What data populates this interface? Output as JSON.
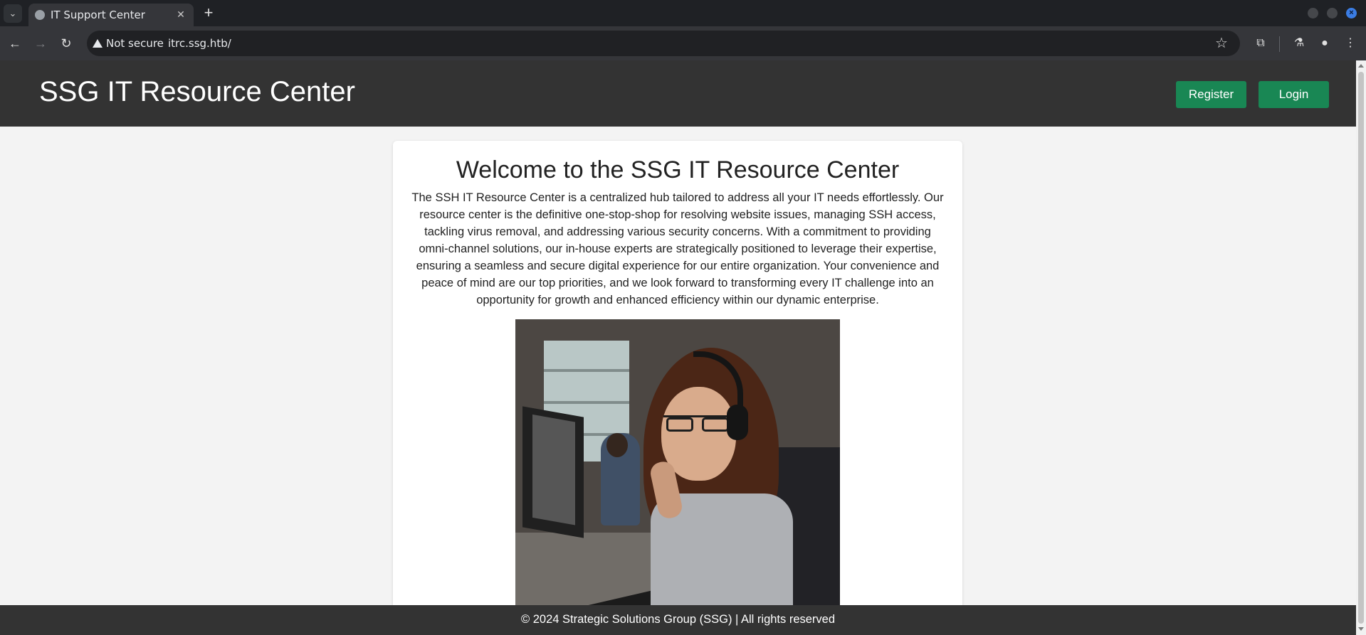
{
  "browser": {
    "tab_title": "IT Support Center",
    "security_label": "Not secure",
    "url": "itrc.ssg.htb/"
  },
  "header": {
    "site_title": "SSG IT Resource Center",
    "register_label": "Register",
    "login_label": "Login",
    "accent_color": "#198754"
  },
  "main": {
    "heading": "Welcome to the SSG IT Resource Center",
    "intro": "The SSH IT Resource Center is a centralized hub tailored to address all your IT needs effortlessly. Our resource center is the definitive one-stop-shop for resolving website issues, managing SSH access, tackling virus removal, and addressing various security concerns. With a commitment to providing omni-channel solutions, our in-house experts are strategically positioned to leverage their expertise, ensuring a seamless and secure digital experience for our entire organization. Your convenience and peace of mind are our top priorities, and we look forward to transforming every IT challenge into an opportunity for growth and enhanced efficiency within our dynamic enterprise."
  },
  "footer": {
    "text": "© 2024 Strategic Solutions Group (SSG) | All rights reserved"
  }
}
